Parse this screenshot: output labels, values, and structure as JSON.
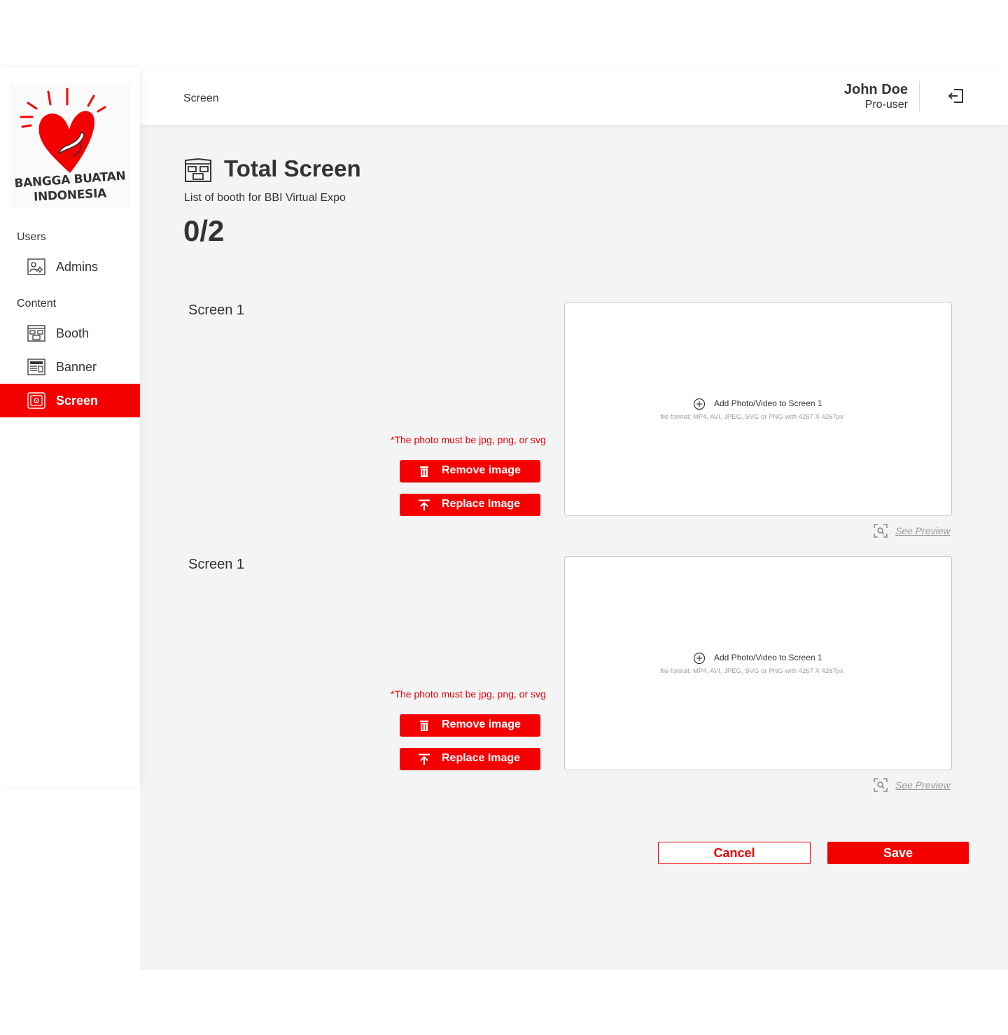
{
  "brand": {
    "logo_line1": "BANGGA BUATAN",
    "logo_line2": "INDONESIA",
    "accent_color": "#f40000"
  },
  "sidebar": {
    "sections": [
      {
        "label": "Users",
        "items": [
          {
            "label": "Admins",
            "icon": "admins-icon"
          }
        ]
      },
      {
        "label": "Content",
        "items": [
          {
            "label": "Booth",
            "icon": "booth-icon"
          },
          {
            "label": "Banner",
            "icon": "banner-icon"
          },
          {
            "label": "Screen",
            "icon": "screen-icon",
            "active": true
          }
        ]
      }
    ]
  },
  "header": {
    "breadcrumb": "Screen",
    "user_name": "John Doe",
    "user_role": "Pro-user",
    "logout_icon": "logout-icon"
  },
  "page": {
    "title": "Total Screen",
    "subtitle": "List of booth for BBI Virtual Expo",
    "count": "0/2",
    "icon": "booth-layout-icon"
  },
  "screens": [
    {
      "label": "Screen 1",
      "note": "*The photo must be jpg, png, or svg",
      "remove_label": "Remove image",
      "replace_label": "Replace Image",
      "upload_prompt": "Add Photo/Video to Screen 1",
      "upload_hint": "file format: MP4, AVI, JPEG, SVG or PNG with 4267 X 4267px",
      "preview_label": "See Preview"
    },
    {
      "label": "Screen 1",
      "note": "*The photo must be jpg, png, or svg",
      "remove_label": "Remove image",
      "replace_label": "Replace Image",
      "upload_prompt": "Add Photo/Video to Screen 1",
      "upload_hint": "file format: MP4, AVI, JPEG, SVG or PNG with 4267 X 4267px",
      "preview_label": "See Preview"
    }
  ],
  "actions": {
    "cancel_label": "Cancel",
    "save_label": "Save"
  }
}
